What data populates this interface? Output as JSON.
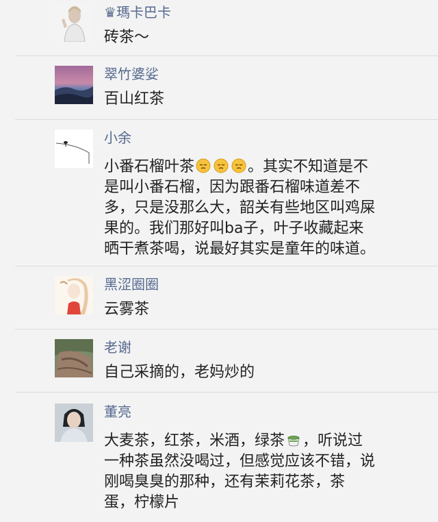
{
  "comments": [
    {
      "name_prefix": "♛",
      "name": "瑪卡巴卡",
      "text": [
        "砖茶～"
      ]
    },
    {
      "name": "翠竹婆娑",
      "text": [
        "百山红茶"
      ]
    },
    {
      "name": "小余",
      "text_first": "小番石榴叶茶",
      "text_after_emoji": "。其实不知道是不",
      "text": [
        "是叫小番石榴，因为跟番石榴味道差不",
        "多，只是没那么大，韶关有些地区叫鸡屎",
        "果的。我们那好叫ba子，叶子收藏起来",
        "晒干煮茶喝，说最好其实是童年的味道。"
      ],
      "emojis": [
        "sleepy-face-emoji",
        "sleepy-face-emoji",
        "sleepy-face-emoji"
      ]
    },
    {
      "name": "黑涩圈圈",
      "text": [
        "云雾茶"
      ]
    },
    {
      "name": "老谢",
      "text": [
        "自己采摘的，老妈炒的"
      ]
    },
    {
      "name": "董亮",
      "text_first": "大麦茶，红茶，米酒，绿茶",
      "text_after_emoji": "，听说过",
      "text": [
        "一种茶虽然没喝过，但感觉应该不错，说",
        "刚喝臭臭的那种，还有茉莉花茶，茶",
        "蛋，柠檬片"
      ],
      "emojis": [
        "tea-cup-emoji"
      ]
    }
  ],
  "colors": {
    "name": "#56698f",
    "text": "#222222",
    "background": "#f3f3f3",
    "divider": "#dcdcdc"
  }
}
